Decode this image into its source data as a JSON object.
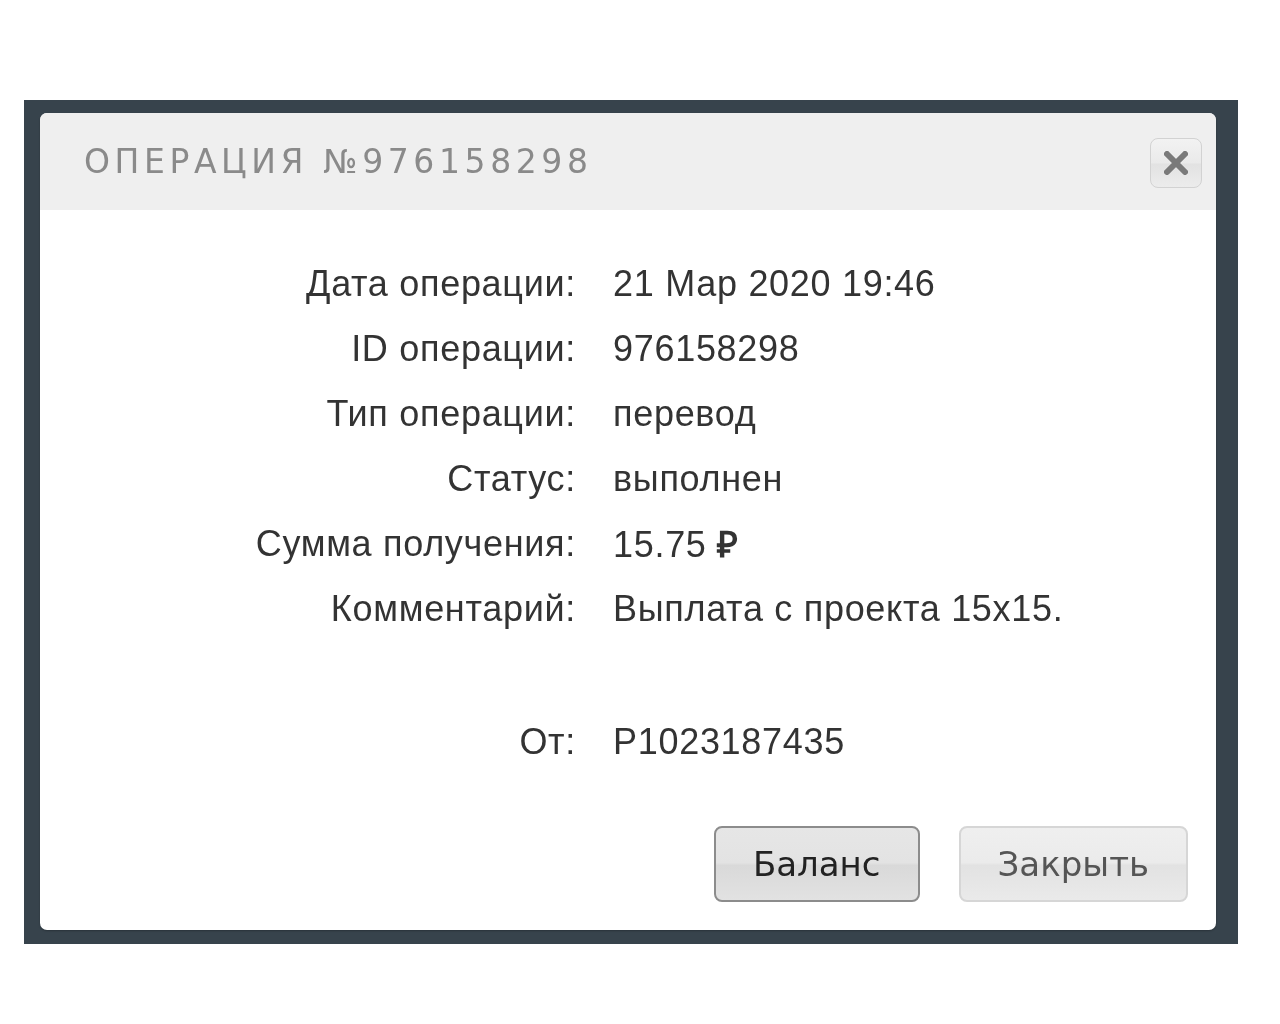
{
  "dialog": {
    "title": "ОПЕРАЦИЯ №976158298"
  },
  "details": [
    {
      "label": "Дата операции:",
      "value": "21 Мар 2020 19:46"
    },
    {
      "label": "ID операции:",
      "value": "976158298"
    },
    {
      "label": "Тип операции:",
      "value": "перевод"
    },
    {
      "label": "Статус:",
      "value": "выполнен"
    },
    {
      "label": "Сумма получения:",
      "value": "15.75 **₽**"
    },
    {
      "label": "Комментарий:",
      "value": "Выплата с проекта 15x15."
    }
  ],
  "sender": {
    "label": "От:",
    "value": "P1023187435"
  },
  "buttons": [
    {
      "label": "Баланс",
      "focused": true
    },
    {
      "label": "Закрыть",
      "focused": false
    }
  ]
}
